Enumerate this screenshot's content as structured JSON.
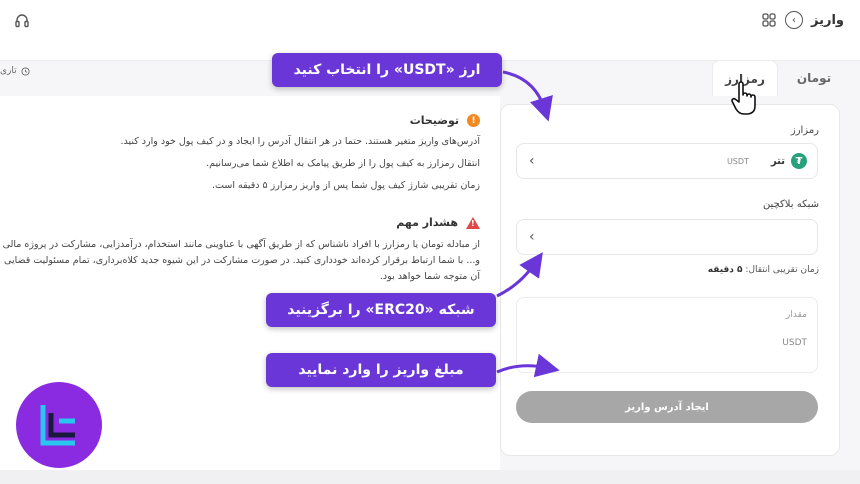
{
  "header": {
    "title": "واریز",
    "back_icon": "chevron-right-icon",
    "grid_icon": "grid-icon",
    "support_icon": "headset-icon"
  },
  "tabs": [
    {
      "label": "تومان",
      "active": false
    },
    {
      "label": "رمزارز",
      "active": true
    }
  ],
  "history": {
    "label": "تاری"
  },
  "notes": {
    "title": "توضیحات",
    "lines": [
      "آدرس‌های واریز متغیر هستند. حتما در هر انتقال آدرس را ایجاد و در کیف پول خود وارد کنید.",
      "انتقال رمزارز به کیف پول را از طریق پیامک به اطلاع شما می‌رسانیم.",
      "زمان تقریبی شارژ کیف پول شما پس از واریز رمزارز ۵ دقیقه است."
    ]
  },
  "warning": {
    "title": "هشدار مهم",
    "text": "از مبادله تومان یا رمزارز با افراد ناشناس که از طریق آگهی با عناوینی مانند استخدام، درآمدزایی، مشارکت در پروژه مالی و... با شما ارتباط برقرار کرده‌اند خودداری کنید. در صورت مشارکت در این شیوه جدید کلاه‌برداری، تمام مسئولیت قضایی آن متوجه شما خواهد بود."
  },
  "form": {
    "currency_label": "رمزارز",
    "currency_name": "تتر",
    "currency_code": "USDT",
    "currency_icon": "tether-icon",
    "network_label": "شبکه بلاکچین",
    "network_time_prefix": "زمان تقریبی انتقال:",
    "network_time_value": "۵ دقیقه",
    "amount_label": "مقدار",
    "amount_unit": "USDT",
    "submit_label": "ایجاد آدرس واریز"
  },
  "callouts": {
    "select_usdt": "ارز «USDT» را انتخاب کنید",
    "select_network": "شبکه «ERC20» را برگزینید",
    "enter_amount": "مبلغ واریز را وارد نمایید"
  },
  "colors": {
    "callout": "#6a36d8",
    "logo_bg": "#8a2be2",
    "tether": "#26a17b",
    "button": "#a7a7a7"
  }
}
